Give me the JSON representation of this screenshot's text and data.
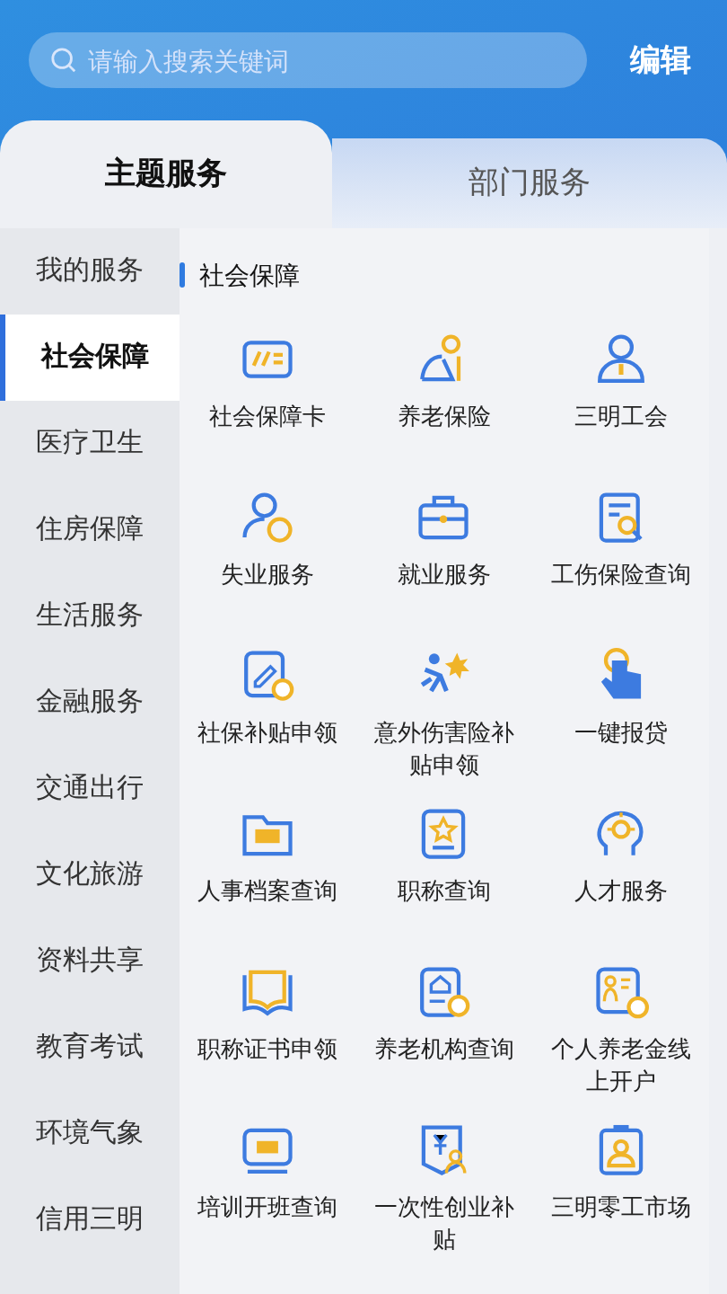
{
  "search": {
    "placeholder": "请输入搜索关键词"
  },
  "edit_button": "编辑",
  "tabs": [
    {
      "label": "主题服务",
      "selected": true
    },
    {
      "label": "部门服务",
      "selected": false
    }
  ],
  "sidebar": {
    "items": [
      {
        "label": "我的服务",
        "selected": false
      },
      {
        "label": "社会保障",
        "selected": true
      },
      {
        "label": "医疗卫生",
        "selected": false
      },
      {
        "label": "住房保障",
        "selected": false
      },
      {
        "label": "生活服务",
        "selected": false
      },
      {
        "label": "金融服务",
        "selected": false
      },
      {
        "label": "交通出行",
        "selected": false
      },
      {
        "label": "文化旅游",
        "selected": false
      },
      {
        "label": "资料共享",
        "selected": false
      },
      {
        "label": "教育考试",
        "selected": false
      },
      {
        "label": "环境气象",
        "selected": false
      },
      {
        "label": "信用三明",
        "selected": false
      }
    ]
  },
  "section": {
    "title": "社会保障",
    "services": [
      {
        "label": "社会保障卡"
      },
      {
        "label": "养老保险"
      },
      {
        "label": "三明工会"
      },
      {
        "label": "失业服务"
      },
      {
        "label": "就业服务"
      },
      {
        "label": "工伤保险查询"
      },
      {
        "label": "社保补贴申领"
      },
      {
        "label": "意外伤害险补贴申领"
      },
      {
        "label": "一键报贷"
      },
      {
        "label": "人事档案查询"
      },
      {
        "label": "职称查询"
      },
      {
        "label": "人才服务"
      },
      {
        "label": "职称证书申领"
      },
      {
        "label": "养老机构查询"
      },
      {
        "label": "个人养老金线上开户"
      },
      {
        "label": "培训开班查询"
      },
      {
        "label": "一次性创业补贴"
      },
      {
        "label": "三明零工市场"
      }
    ]
  }
}
